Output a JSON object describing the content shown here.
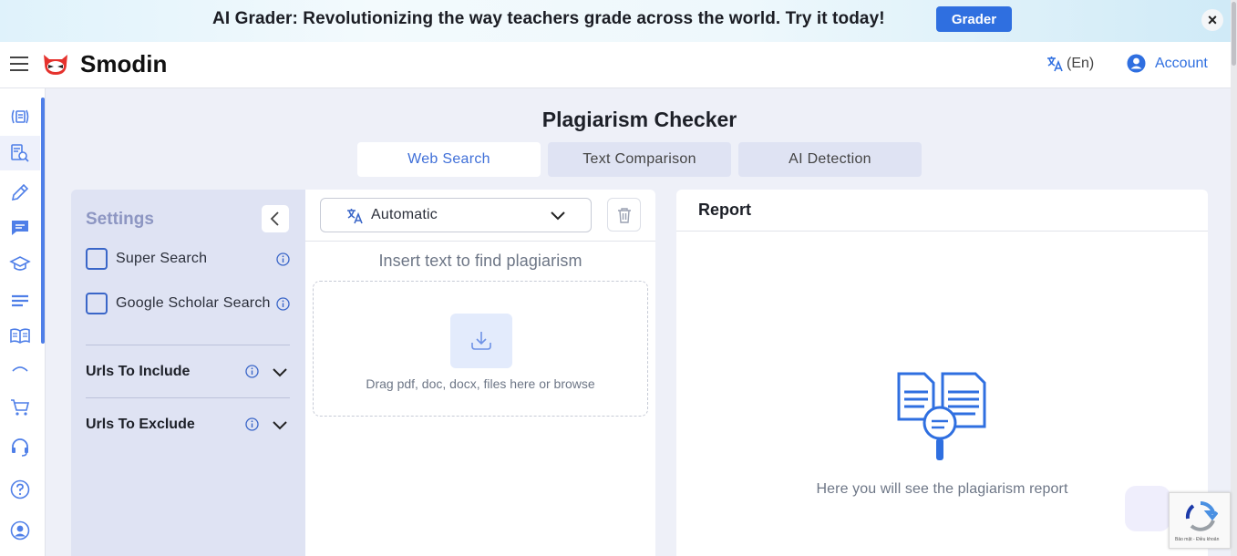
{
  "banner": {
    "text": "AI Grader: Revolutionizing the way teachers grade across the world. Try it today!",
    "button_label": "Grader",
    "close_symbol": "×"
  },
  "header": {
    "brand": "Smodin",
    "language_label": "(En)",
    "account_label": "Account"
  },
  "sidebar": {
    "icons": [
      "rewriter-icon",
      "plagiarism-checker-icon",
      "pencil-icon",
      "chat-icon",
      "graduation-cap-icon",
      "summarizer-lines-icon",
      "book-icon",
      "more-icon",
      "cart-icon",
      "headset-icon",
      "help-icon",
      "user-icon"
    ]
  },
  "page": {
    "title": "Plagiarism Checker",
    "tabs": [
      {
        "label": "Web Search",
        "active": true
      },
      {
        "label": "Text Comparison",
        "active": false
      },
      {
        "label": "AI Detection",
        "active": false
      }
    ]
  },
  "settings": {
    "title": "Settings",
    "options": [
      {
        "label": "Super Search",
        "checked": false
      },
      {
        "label": "Google Scholar Search",
        "checked": false
      }
    ],
    "sections": [
      {
        "label": "Urls To Include"
      },
      {
        "label": "Urls To Exclude"
      }
    ]
  },
  "input": {
    "language_value": "Automatic",
    "placeholder": "Insert text to find plagiarism",
    "drop_text": "Drag pdf, doc, docx, files here or browse"
  },
  "report": {
    "title": "Report",
    "empty_message": "Here you will see the plagiarism report"
  },
  "recaptcha": {
    "footer": "Bảo mật - Điều khoản"
  },
  "colors": {
    "accent": "#2f6fe0",
    "settings_bg": "#dfe3f3",
    "page_bg": "#eef0f8"
  }
}
